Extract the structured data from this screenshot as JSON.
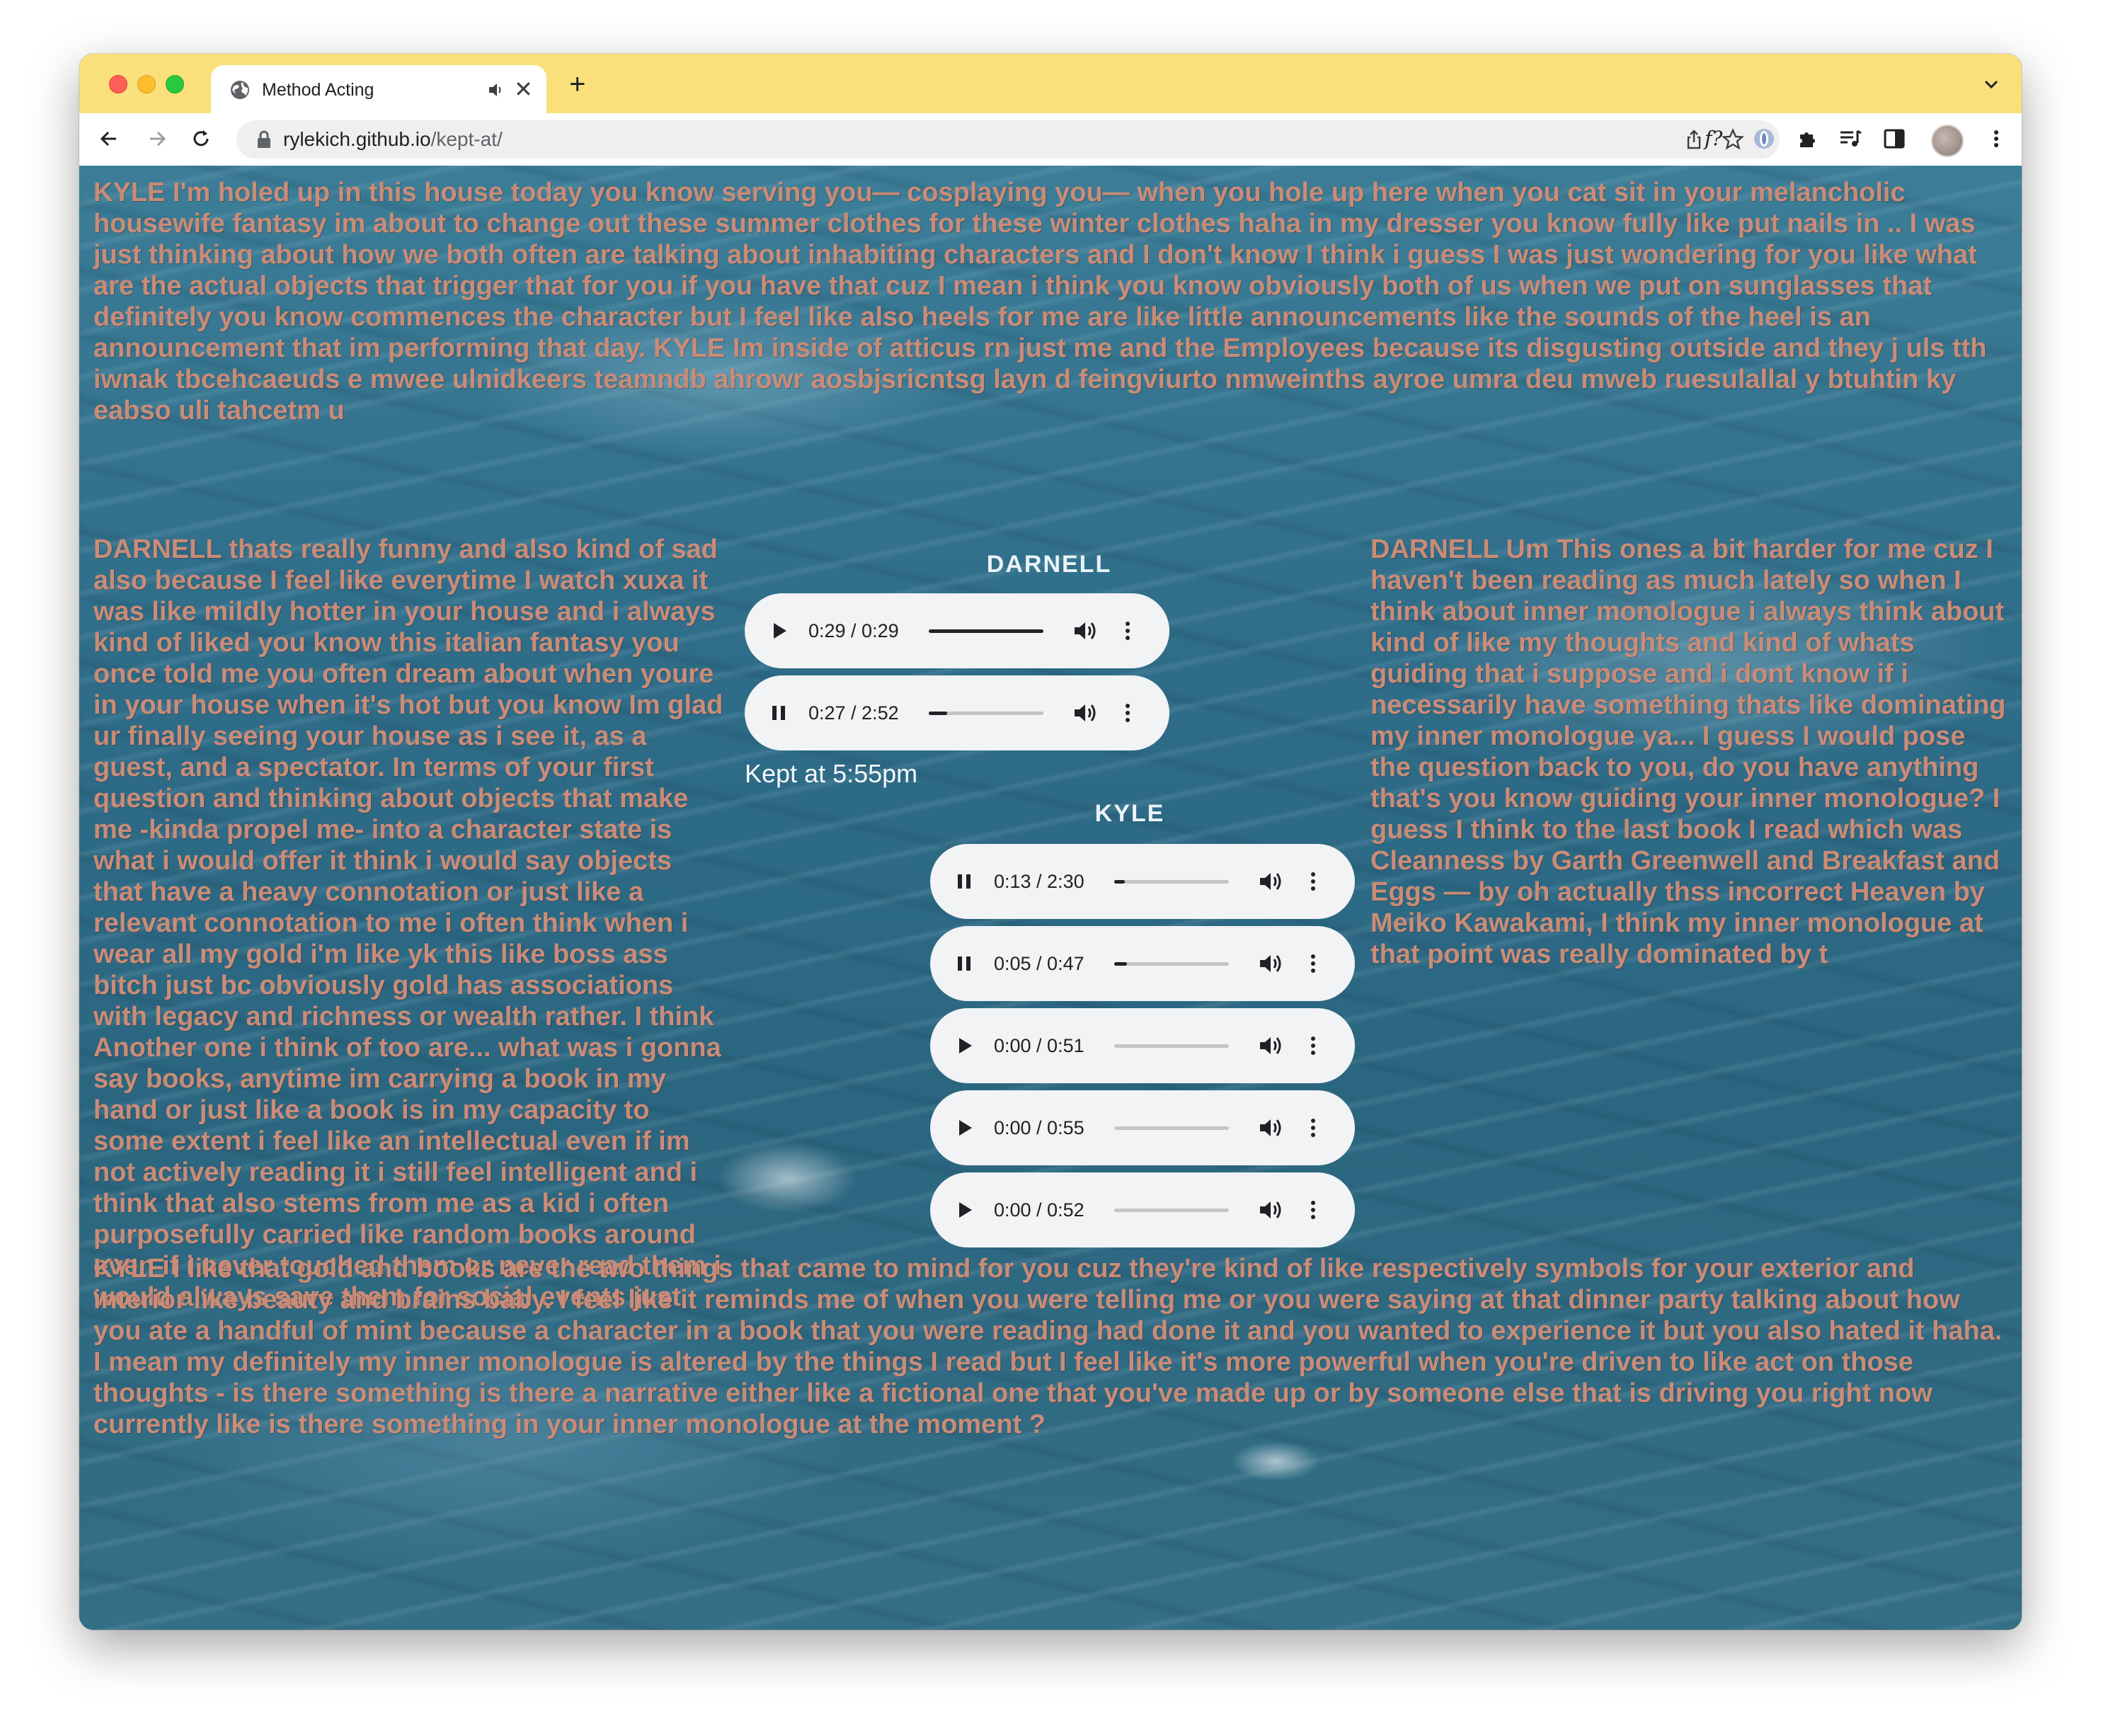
{
  "browser": {
    "tab_title": "Method Acting",
    "url_host": "rylekich.github.io",
    "url_path": "/kept-at/",
    "extension_fx": "f?"
  },
  "page": {
    "paragraphs": {
      "kyle_intro": "KYLE I'm holed up in this house today you know serving you— cosplaying you— when you hole up here when you cat sit in your melancholic housewife fantasy im about to change out these summer clothes for these winter clothes haha in my dresser you know fully like put nails in .. I was just thinking about how we both often are talking about inhabiting characters and I don't know I think i guess I was just wondering for you like what are the actual objects that trigger that for you if you have that cuz I mean i think you know obviously both of us when we put on sunglasses that definitely you know commences the character but I feel like also heels for me are like little announcements like the sounds of the heel is an announcement that im performing that day. KYLE Im inside of atticus rn just me and the Employees because its disgusting outside and they j uls tth iwnak tbcehcaeuds e mwee ulnidkeers teamndb ahrowr aosbjsricntsg layn d feingviurto nmweinths ayroe umra deu mweb ruesulallal y btuhtin ky eabso uli tahcetm u",
      "darnell_left": "DARNELL thats really funny and also kind of sad also because I feel like everytime I watch xuxa it was like mildly hotter in your house and i always kind of liked you know this italian fantasy you once told me you often dream about when youre in your house when it's hot but you know Im glad ur finally seeing your house as i see it, as a guest, and a spectator. In terms of your first question and thinking about objects that make me -kinda propel me- into a character state is what i would offer it think i would say objects that have a heavy connotation or just like a relevant connotation to me i often think when i wear all my gold i'm like yk this like boss ass bitch just bc obviously gold has associations with legacy and richness or wealth rather. I think Another one i think of too are... what was i gonna say books, anytime im carrying a book in my hand or just like a book is in my capacity to some extent i feel like an intellectual even if im not actively reading it i still feel intelligent and i think that also stems from me as a kid i often purposefully carried like random books around even if i never touched them or never read them i would always save them for social events just",
      "darnell_right": "DARNELL Um This ones a bit harder for me cuz I haven't been reading as much lately so when I think about inner monologue i always think about kind of like my thoughts and kind of whats guiding that i suppose and i dont know if i necessarily have something thats like dominating my inner monologue ya... I guess I would pose the question back to you, do you have anything that's you know guiding your inner monologue? I guess I think to the last book I read which was Cleanness by Garth Greenwell and Breakfast and Eggs — by oh actually thss incorrect Heaven by Meiko Kawakami, I think my inner monologue at that point was really dominated by t",
      "kyle_bottom": "KYLE I like that gold and books are the two things that came to mind for you cuz they're kind of like respectively symbols for your exterior and interior like beauty and brains baby. I feel like it reminds me of when you were telling me or you were saying at that dinner party talking about how you ate a handful of mint because a character in a book that you were reading had done it and you wanted to experience it but you also hated it haha. I mean my definitely my inner monologue is altered by the things I read but I feel like it's more powerful when you're driven to like act on those thoughts - is there something is there a narrative either like a fictional one that you've made up or by someone else that is driving you right now currently like is there something in your inner monologue at the moment ?"
    },
    "darnell_label": "DARNELL",
    "kyle_label": "KYLE",
    "kept_at": "Kept at 5:55pm",
    "darnell_players": [
      {
        "state": "play",
        "time": "0:29 / 0:29",
        "progress": 1.0
      },
      {
        "state": "pause",
        "time": "0:27 / 2:52",
        "progress": 0.16
      }
    ],
    "kyle_players": [
      {
        "state": "pause",
        "time": "0:13 / 2:30",
        "progress": 0.09
      },
      {
        "state": "pause",
        "time": "0:05 / 0:47",
        "progress": 0.11
      },
      {
        "state": "play",
        "time": "0:00 / 0:51",
        "progress": 0.0
      },
      {
        "state": "play",
        "time": "0:00 / 0:55",
        "progress": 0.0
      },
      {
        "state": "play",
        "time": "0:00 / 0:52",
        "progress": 0.0
      }
    ]
  },
  "colors": {
    "tabstrip": "#f9e07a",
    "text": "#c98c78",
    "water": "#2e6c88"
  }
}
